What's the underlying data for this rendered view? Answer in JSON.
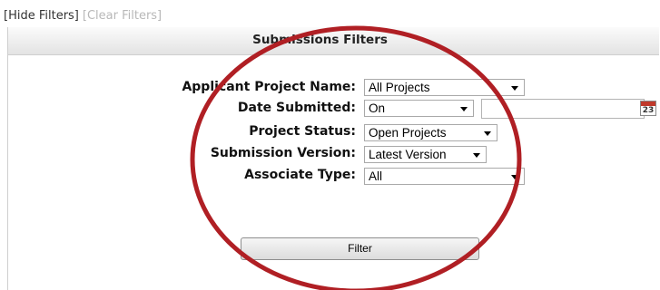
{
  "toolbar": {
    "hide_filters": "[Hide Filters]",
    "clear_filters": "[Clear Filters]"
  },
  "panel": {
    "title": "Submissions Filters"
  },
  "filters": {
    "applicant_project_name": {
      "label": "Applicant Project Name:",
      "value": "All Projects"
    },
    "date_submitted": {
      "label": "Date Submitted:",
      "value": "On",
      "date_value": "",
      "calendar_icon_text": "23"
    },
    "project_status": {
      "label": "Project Status:",
      "value": "Open Projects"
    },
    "submission_version": {
      "label": "Submission Version:",
      "value": "Latest Version"
    },
    "associate_type": {
      "label": "Associate Type:",
      "value": "All"
    }
  },
  "actions": {
    "filter_label": "Filter"
  },
  "colors": {
    "annotation_ellipse": "#b01f24",
    "calendar_header": "#c0392b"
  },
  "icons": [
    "dropdown-arrow-icon",
    "calendar-icon"
  ]
}
